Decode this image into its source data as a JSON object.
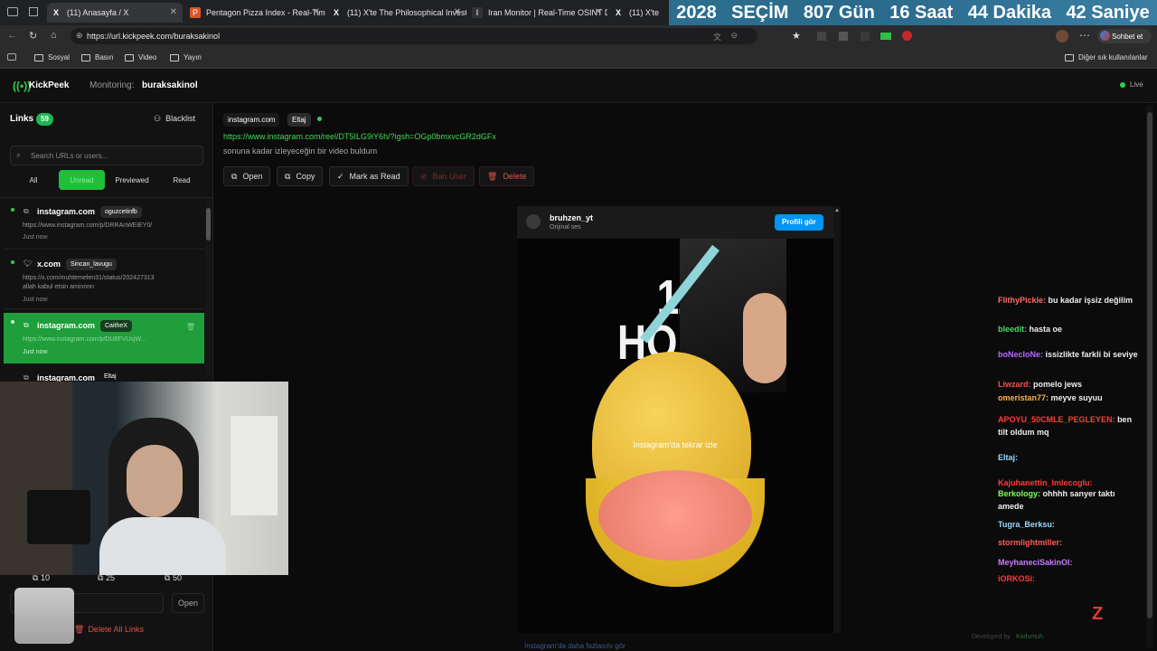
{
  "tabs": [
    {
      "title": "(11) Anasayfa / X",
      "icon": "X"
    },
    {
      "title": "Pentagon Pizza Index - Real-Time",
      "icon": "P"
    },
    {
      "title": "(11) X'te The Philosophical Invest",
      "icon": "X"
    },
    {
      "title": "Iran Monitor | Real-Time OSINT D",
      "icon": "I"
    },
    {
      "title": "(11) X'te",
      "icon": "X"
    }
  ],
  "countdown": {
    "year": "2028",
    "label": "SEÇİM",
    "days": "807 Gün",
    "hours": "16 Saat",
    "minutes": "44 Dakika",
    "seconds": "42 Saniye"
  },
  "browser": {
    "url": "https://url.kickpeek.com/buraksakinol",
    "chat_label": "Sohbet et"
  },
  "bookmarks": [
    "Sosyal",
    "Basın",
    "Video",
    "Yayın"
  ],
  "bookmarks_other": "Diğer sık kullanılanlar",
  "app": {
    "name": "KickPeek",
    "monitoring_label": "Monitoring:",
    "monitoring_user": "buraksakinol",
    "live": "Live"
  },
  "sidebar": {
    "links_label": "Links",
    "links_count": "59",
    "blacklist": "Blacklist",
    "search_placeholder": "Search URLs or users...",
    "filters": [
      "All",
      "Unread",
      "Previewed",
      "Read"
    ],
    "items": [
      {
        "domain": "instagram.com",
        "user": "oguzcetinfb",
        "url": "https://www.instagram.com/p/DRRAnWEiEY0/",
        "text": "",
        "time": "Just now"
      },
      {
        "domain": "x.com",
        "user": "Sincan_lavugu",
        "url": "https://x.com/muhtemelen31/status/202427313",
        "text": "allah kabul etsin aminnnn",
        "time": "Just now"
      },
      {
        "domain": "instagram.com",
        "user": "CaitheX",
        "url": "https://www.instagram.com/p/DU8FVUsjW...",
        "text": "",
        "time": "Just now"
      },
      {
        "domain": "instagram.com",
        "user": "Eltaj",
        "url": "",
        "text": "",
        "time": ""
      }
    ],
    "counts": [
      "10",
      "25",
      "50"
    ],
    "open": "Open",
    "delete_all": "Delete All Links"
  },
  "detail": {
    "domain": "instagram.com",
    "user": "Eltaj",
    "url": "https://www.instagram.com/reel/DT5ILG9iY6h/?igsh=OGp0bmxvcGR2dGFx",
    "message": "sonuna kadar izleyeceğin bir video buldum",
    "buttons": {
      "open": "Open",
      "copy": "Copy",
      "mark": "Mark as Read",
      "ban": "Ban User",
      "delete": "Delete"
    }
  },
  "embed": {
    "account": "bruhzen_yt",
    "audio": "Orijinal ses",
    "profile_btn": "Profili gör",
    "overlay_big1": "11+",
    "overlay_big2": "HOURS",
    "replay": "Instagram'da tekrar izle",
    "more": "Instagram'da daha fazlasını gör"
  },
  "chat": [
    {
      "user": "FlithyPickle:",
      "msg": "bu kadar işsiz değilim",
      "color": "#ff6b6b"
    },
    {
      "user": "bleedit:",
      "msg": "hasta oe",
      "color": "#4cd964"
    },
    {
      "user": "boNecIoNe:",
      "msg": "issizlikte farkli bi seviye",
      "color": "#b36bff"
    },
    {
      "user": "Liwzard:",
      "msg": "pomelo jews",
      "color": "#ff4d4d"
    },
    {
      "user": "omeristan77:",
      "msg": "meyve suyuu",
      "color": "#ffb347"
    },
    {
      "user": "APOYU_50CMLE_PEGLEYEN:",
      "msg": "ben tilt oldum mq",
      "color": "#ff3b3b"
    },
    {
      "user": "Eltaj:",
      "msg": "",
      "color": "#9ad8ff"
    },
    {
      "user": "Kajuhanettin_Imlecoglu:",
      "msg": "",
      "color": "#ff3b3b"
    },
    {
      "user": "Berkology:",
      "msg": "ohhhh sanyer taktı amede",
      "color": "#7fff5a"
    },
    {
      "user": "Tugra_Berksu:",
      "msg": "",
      "color": "#9ad8ff"
    },
    {
      "user": "stormlightmiller:",
      "msg": "",
      "color": "#ff5a5a"
    },
    {
      "user": "MeyhaneciSakinOl:",
      "msg": "",
      "color": "#c77dff"
    },
    {
      "user": "iORKOSi:",
      "msg": "",
      "color": "#ff3b3b"
    }
  ],
  "footer": {
    "developed": "Developed by",
    "dev_name": "Kodumuh"
  },
  "colors": {
    "accent": "#1db954",
    "green_row": "#1f9e3b",
    "link_green": "#3ddc54",
    "instagram_blue": "#0095f6",
    "delete_red": "#e0524b"
  }
}
